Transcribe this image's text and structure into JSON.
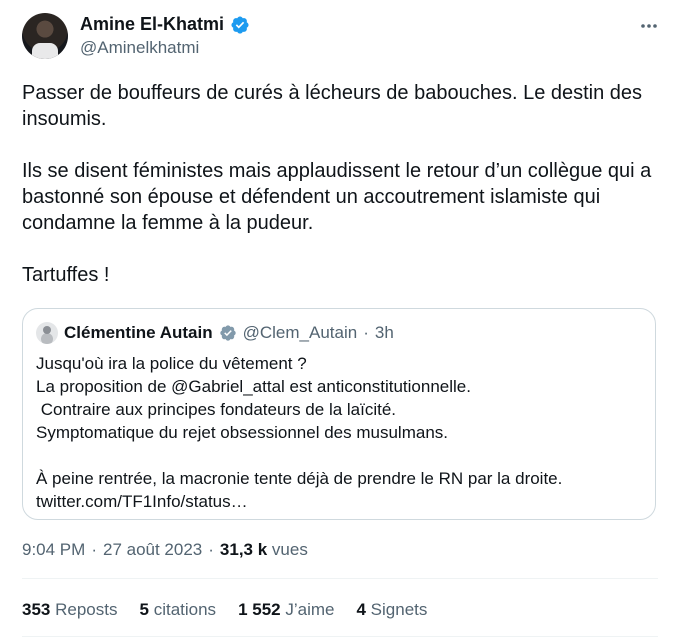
{
  "author": {
    "name": "Amine El-Khatmi",
    "handle": "@Aminelkhatmi"
  },
  "tweet": {
    "paragraphs": [
      "Passer de bouffeurs de curés à lécheurs de babouches. Le destin des insoumis.",
      "Ils se disent féministes mais applaudissent le retour d’un collègue qui a bastonné son épouse et défendent un accoutrement islamiste qui condamne la femme à la pudeur.",
      "Tartuffes !"
    ]
  },
  "quote": {
    "name": "Clémentine Autain",
    "handle": "@Clem_Autain",
    "separator": "·",
    "time": "3h",
    "lines": [
      "Jusqu'où ira la police du vêtement ?",
      "La proposition de @Gabriel_attal est anticonstitutionnelle.",
      " Contraire aux principes fondateurs de la laïcité.",
      "Symptomatique du rejet obsessionnel des musulmans.",
      "",
      "À peine rentrée, la macronie tente déjà de prendre le RN par la droite.",
      "twitter.com/TF1Info/status…"
    ]
  },
  "meta": {
    "time": "9:04 PM",
    "separator": "·",
    "date": "27 août 2023",
    "views_count": "31,3 k",
    "views_label": "vues"
  },
  "stats": {
    "reposts_count": "353",
    "reposts_label": "Reposts",
    "quotes_count": "5",
    "quotes_label": "citations",
    "likes_count": "1 552",
    "likes_label": "J’aime",
    "bookmarks_count": "4",
    "bookmarks_label": "Signets"
  },
  "colors": {
    "verified_blue": "#1d9bf0",
    "secondary_text": "#536471"
  }
}
